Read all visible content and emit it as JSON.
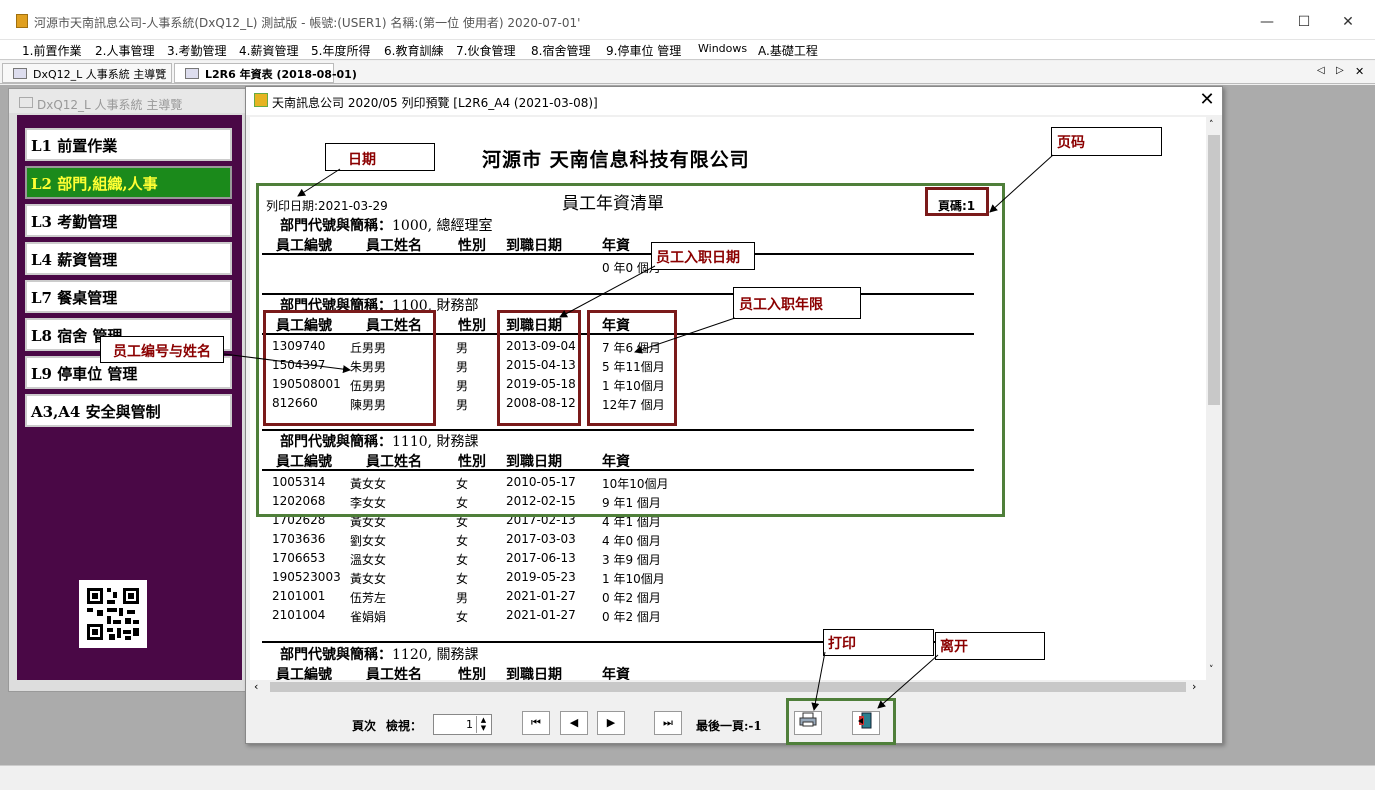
{
  "window": {
    "title": "河源市天南訊息公司-人事系統(DxQ12_L) 測試版 - 帳號:(USER1) 名稱:(第一位 使用者) 2020-07-01'",
    "minimize": "—",
    "maximize": "☐",
    "close": "✕"
  },
  "menu": [
    "1.前置作業",
    "2.人事管理",
    "3.考勤管理",
    "4.薪資管理",
    "5.年度所得",
    "6.教育訓練",
    "7.伙食管理",
    "8.宿舍管理",
    "9.停車位 管理",
    "Windows",
    "A.基礎工程"
  ],
  "tabs": [
    "DxQ12_L 人事系統 主導覽",
    "L2R6 年資表 (2018-08-01)"
  ],
  "tab_nav": [
    "◁",
    "▷",
    "✕"
  ],
  "nav": {
    "title": "DxQ12_L 人事系統 主導覽",
    "items": [
      "L1 前置作業",
      "L2 部門,組織,人事",
      "L3 考勤管理",
      "L4 薪資管理",
      "L7 餐桌管理",
      "L8 宿舍 管理",
      "L9 停車位 管理",
      "A3,A4 安全與管制"
    ],
    "active_index": 1
  },
  "preview": {
    "title": "天南訊息公司 2020/05 列印預覽 [L2R6_A4 (2021-03-08)]",
    "close": "✕",
    "company": "河源市 天南信息科技有限公司",
    "report_title": "員工年資清單",
    "print_date": "列印日期:2021-03-29",
    "page": "頁碼:1",
    "dept_label": "部門代號與簡稱：",
    "columns": [
      "員工編號",
      "員工姓名",
      "性別",
      "到職日期",
      "年資"
    ],
    "departments": [
      {
        "code": "1000, 總經理室",
        "rows": [
          {
            "id": "",
            "name": "",
            "sex": "",
            "date": "",
            "tenure": "0 年0 個月"
          }
        ]
      },
      {
        "code": "1100, 財務部",
        "rows": [
          {
            "id": "1309740",
            "name": "丘男男",
            "sex": "男",
            "date": "2013-09-04",
            "tenure": "7 年6 個月"
          },
          {
            "id": "1504397",
            "name": "朱男男",
            "sex": "男",
            "date": "2015-04-13",
            "tenure": "5 年11個月"
          },
          {
            "id": "190508001",
            "name": "伍男男",
            "sex": "男",
            "date": "2019-05-18",
            "tenure": "1 年10個月"
          },
          {
            "id": "812660",
            "name": "陳男男",
            "sex": "男",
            "date": "2008-08-12",
            "tenure": "12年7 個月"
          }
        ]
      },
      {
        "code": "1110, 財務課",
        "rows": [
          {
            "id": "1005314",
            "name": "黃女女",
            "sex": "女",
            "date": "2010-05-17",
            "tenure": "10年10個月"
          },
          {
            "id": "1202068",
            "name": "李女女",
            "sex": "女",
            "date": "2012-02-15",
            "tenure": "9 年1 個月"
          },
          {
            "id": "1702628",
            "name": "黃女女",
            "sex": "女",
            "date": "2017-02-13",
            "tenure": "4 年1 個月"
          },
          {
            "id": "1703636",
            "name": "劉女女",
            "sex": "女",
            "date": "2017-03-03",
            "tenure": "4 年0 個月"
          },
          {
            "id": "1706653",
            "name": "溫女女",
            "sex": "女",
            "date": "2017-06-13",
            "tenure": "3 年9 個月"
          },
          {
            "id": "190523003",
            "name": "黃女女",
            "sex": "女",
            "date": "2019-05-23",
            "tenure": "1 年10個月"
          },
          {
            "id": "2101001",
            "name": "伍芳左",
            "sex": "男",
            "date": "2021-01-27",
            "tenure": "0 年2 個月"
          },
          {
            "id": "2101004",
            "name": "雀娟娟",
            "sex": "女",
            "date": "2021-01-27",
            "tenure": "0 年2 個月"
          }
        ]
      },
      {
        "code": "1120, 關務課",
        "rows": []
      }
    ]
  },
  "footer": {
    "page_label": "頁次",
    "view_label": "檢視：",
    "page_value": "1",
    "first": "⏮",
    "prev": "◀",
    "next": "▶",
    "last": "⏭",
    "last_page_text": "最後一頁:-1"
  },
  "callouts": {
    "date": "日期",
    "page": "页码",
    "hire_date": "员工入职日期",
    "tenure": "员工入职年限",
    "emp_id_name": "员工编号与姓名",
    "print": "打印",
    "exit": "离开"
  },
  "colors": {
    "nav_bg": "#4a0846",
    "nav_active_bg": "#1b8a1b",
    "nav_active_fg": "#ffff33",
    "callout_text": "#8b0000",
    "red_box": "#7a1a1a",
    "green_box": "#4f7f3a"
  }
}
